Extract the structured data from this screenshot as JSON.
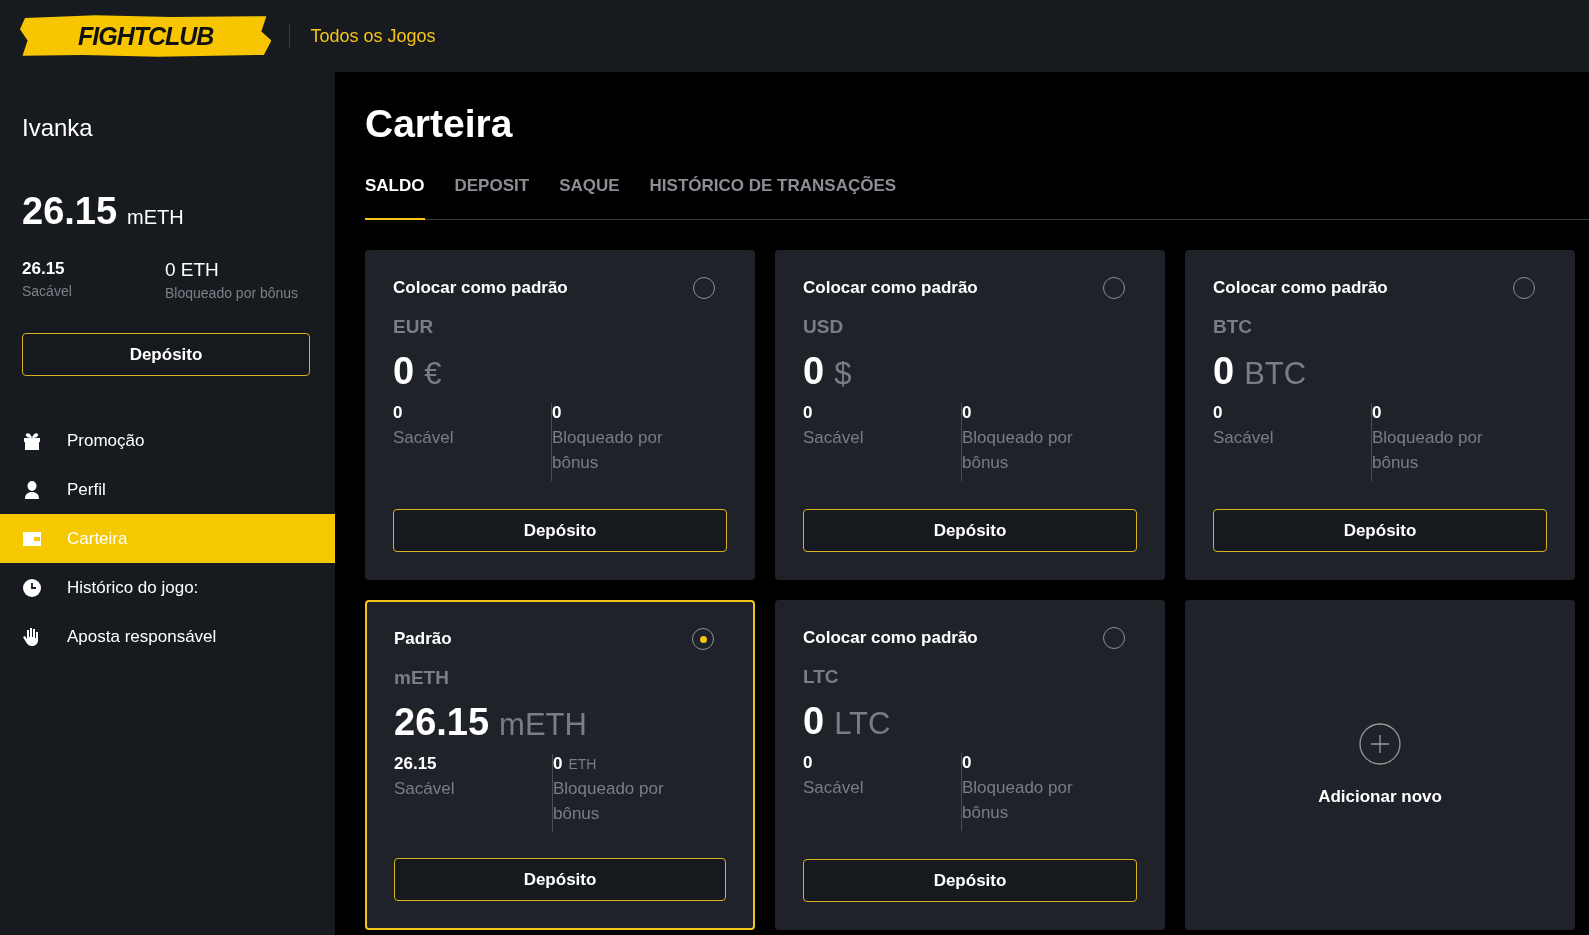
{
  "header": {
    "logo": "FIGHTCLUB",
    "nav_link": "Todos os Jogos"
  },
  "sidebar": {
    "username": "Ivanka",
    "balance": {
      "amount": "26.15",
      "unit": "mETH"
    },
    "stats": [
      {
        "value": "26.15",
        "label": "Sacável"
      },
      {
        "value": "0 ETH",
        "label": "Bloqueado por bônus"
      }
    ],
    "deposit_button": "Depósito",
    "items": [
      {
        "label": "Promoção",
        "kind": "gift",
        "selected": false
      },
      {
        "label": "Perfil",
        "kind": "user",
        "selected": false
      },
      {
        "label": "Carteira",
        "kind": "wallet",
        "selected": true
      },
      {
        "label": "Histórico do jogo:",
        "kind": "clock",
        "selected": false
      },
      {
        "label": "Aposta responsável",
        "kind": "hand",
        "selected": false
      }
    ]
  },
  "main": {
    "title": "Carteira",
    "tabs": [
      {
        "label": "SALDO",
        "selected": true
      },
      {
        "label": "DEPOSIT",
        "selected": false
      },
      {
        "label": "SAQUE",
        "selected": false
      },
      {
        "label": "HISTÓRICO DE TRANSAÇÕES",
        "selected": false
      }
    ],
    "cards": [
      {
        "kind": "wallet",
        "header": "Colocar como padrão",
        "selected": false,
        "currency": "EUR",
        "amount": "0",
        "unit": "€",
        "withdrawable": "0",
        "withdrawable_label": "Sacável",
        "blocked": "0",
        "blocked_label": "Bloqueado por bônus",
        "button": "Depósito"
      },
      {
        "kind": "wallet",
        "header": "Colocar como padrão",
        "selected": false,
        "currency": "USD",
        "amount": "0",
        "unit": "$",
        "withdrawable": "0",
        "withdrawable_label": "Sacável",
        "blocked": "0",
        "blocked_label": "Bloqueado por bônus",
        "button": "Depósito"
      },
      {
        "kind": "wallet",
        "header": "Colocar como padrão",
        "selected": false,
        "currency": "BTC",
        "amount": "0",
        "unit": "BTC",
        "withdrawable": "0",
        "withdrawable_label": "Sacável",
        "blocked": "0",
        "blocked_label": "Bloqueado por bônus",
        "button": "Depósito"
      },
      {
        "kind": "wallet",
        "header": "Padrão",
        "selected": true,
        "currency": "mETH",
        "amount": "26.15",
        "unit": "mETH",
        "withdrawable": "26.15",
        "withdrawable_label": "Sacável",
        "blocked": "0",
        "blocked_unit": "ETH",
        "blocked_label": "Bloqueado por bônus",
        "button": "Depósito"
      },
      {
        "kind": "wallet",
        "header": "Colocar como padrão",
        "selected": false,
        "currency": "LTC",
        "amount": "0",
        "unit": "LTC",
        "withdrawable": "0",
        "withdrawable_label": "Sacável",
        "blocked": "0",
        "blocked_label": "Bloqueado por bônus",
        "button": "Depósito"
      },
      {
        "kind": "add",
        "label": "Adicionar novo"
      }
    ]
  }
}
